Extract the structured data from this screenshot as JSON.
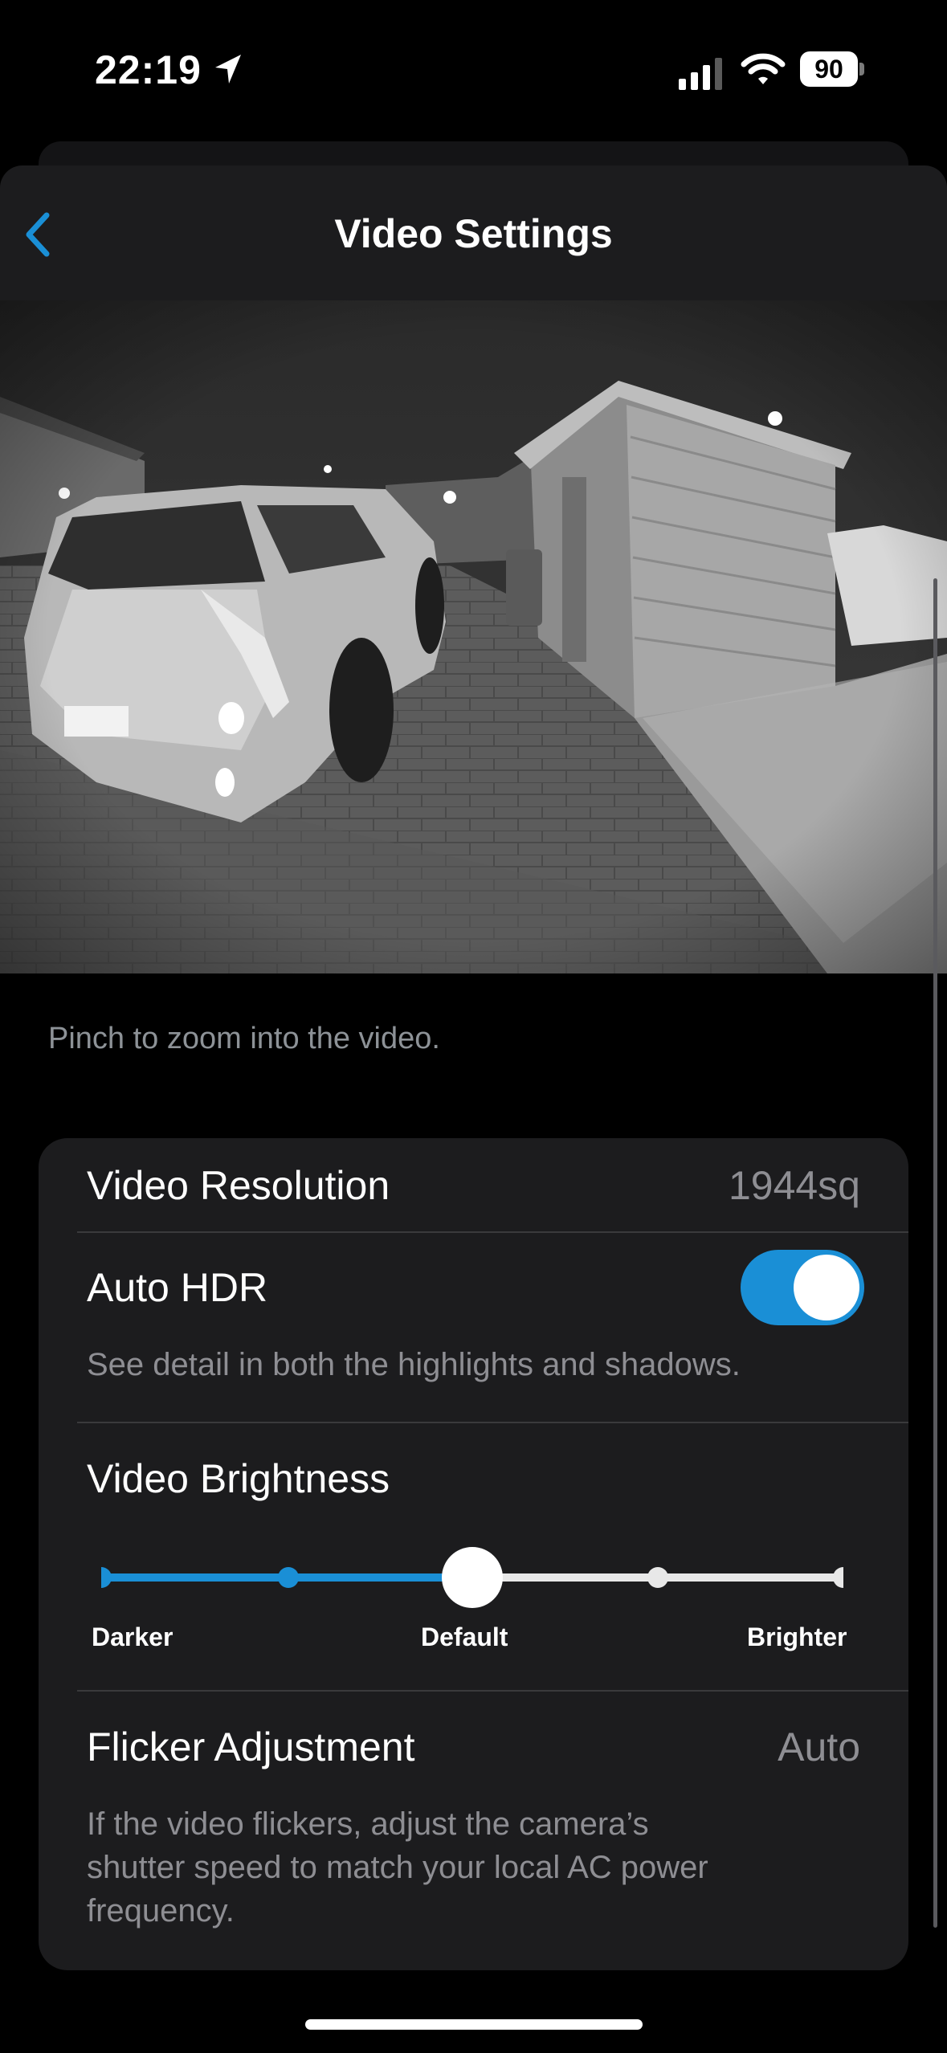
{
  "status_bar": {
    "time": "22:19",
    "battery": "90",
    "icons": [
      "location-arrow-icon",
      "cellular-signal-icon",
      "wifi-icon",
      "battery-icon"
    ]
  },
  "nav": {
    "title": "Video Settings",
    "back_icon": "chevron-left-icon",
    "accent_color": "#1a8fd6"
  },
  "video": {
    "hint": "Pinch to zoom into the video."
  },
  "settings": {
    "resolution": {
      "label": "Video Resolution",
      "value": "1944sq"
    },
    "hdr": {
      "label": "Auto HDR",
      "enabled": true,
      "description": "See detail in both the highlights and shadows."
    },
    "brightness": {
      "label": "Video Brightness",
      "steps": 5,
      "selected_step": 3,
      "min_label": "Darker",
      "mid_label": "Default",
      "max_label": "Brighter"
    },
    "flicker": {
      "label": "Flicker Adjustment",
      "value": "Auto",
      "description_line1": "If the video flickers, adjust the camera’s",
      "description_line2": "shutter speed to match your local AC power",
      "description_line3": "frequency."
    }
  }
}
